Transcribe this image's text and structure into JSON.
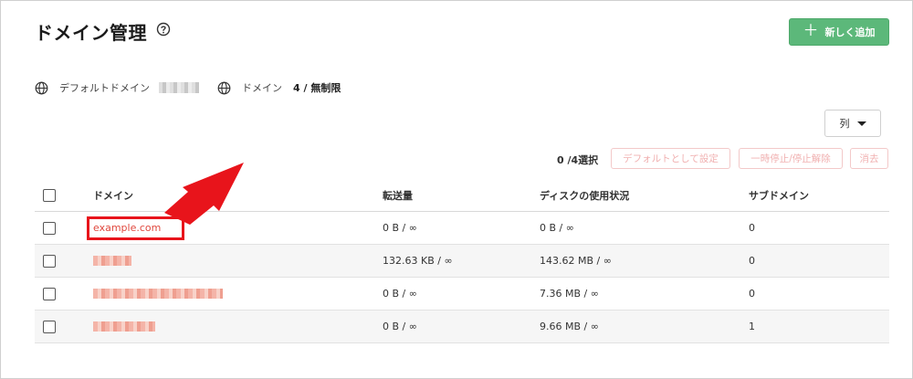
{
  "page": {
    "title": "ドメイン管理",
    "add_button_label": "新しく追加"
  },
  "info": {
    "default_domain_label": "デフォルトドメイン",
    "domain_count_label": "ドメイン",
    "domain_count_value": "4 / 無制限"
  },
  "toolbar": {
    "column_button_label": "列",
    "selection_count": "0 /4選択",
    "set_default_label": "デフォルトとして設定",
    "suspend_label": "一時停止/停止解除",
    "delete_label": "消去"
  },
  "table": {
    "headers": {
      "domain": "ドメイン",
      "transfer": "転送量",
      "disk": "ディスクの使用状況",
      "subdomains": "サブドメイン"
    },
    "rows": [
      {
        "domain": "example.com",
        "transfer": "0 B / ∞",
        "disk": "0 B / ∞",
        "subdomains": "0"
      },
      {
        "domain": "",
        "transfer": "132.63 KB / ∞",
        "disk": "143.62 MB / ∞",
        "subdomains": "0"
      },
      {
        "domain": "",
        "transfer": "0 B / ∞",
        "disk": "7.36 MB / ∞",
        "subdomains": "0"
      },
      {
        "domain": "",
        "transfer": "0 B / ∞",
        "disk": "9.66 MB / ∞",
        "subdomains": "1"
      }
    ]
  },
  "colors": {
    "accent_green": "#5cb87a",
    "link_red": "#e0483e",
    "highlight_red": "#e8141b",
    "disabled_button_text": "#f0b0b0"
  },
  "icons": [
    "help-icon",
    "plus-icon",
    "globe-icon",
    "caret-down-icon",
    "red-arrow"
  ]
}
